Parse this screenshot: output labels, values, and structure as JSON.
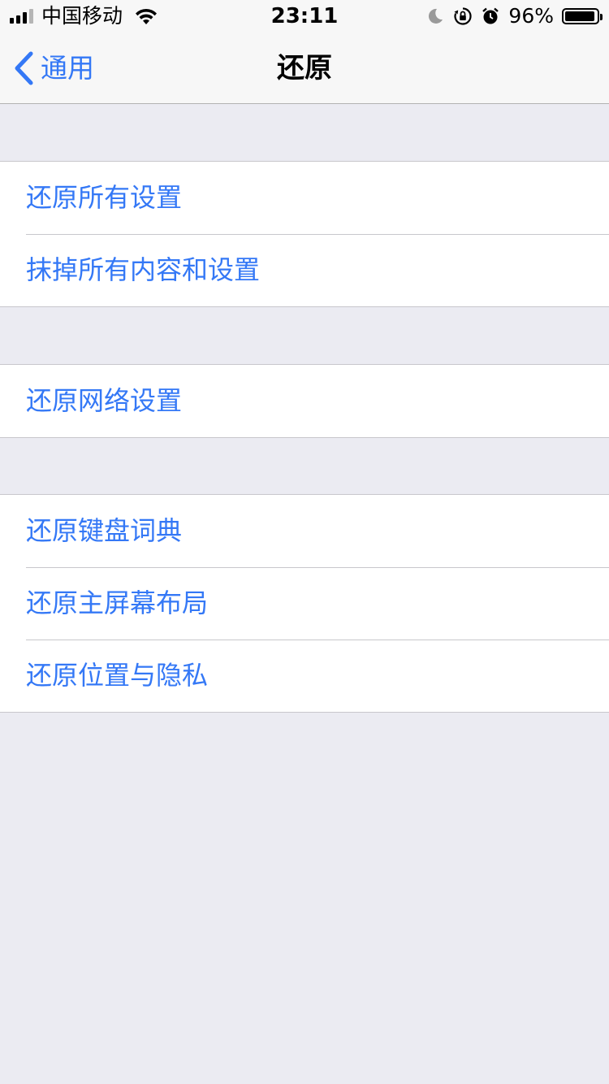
{
  "status_bar": {
    "carrier": "中国移动",
    "time": "23:11",
    "battery_percent": "96%",
    "battery_level": 0.96
  },
  "nav": {
    "back_label": "通用",
    "title": "还原"
  },
  "groups": [
    {
      "items": [
        {
          "label": "还原所有设置"
        },
        {
          "label": "抹掉所有内容和设置"
        }
      ]
    },
    {
      "items": [
        {
          "label": "还原网络设置"
        }
      ]
    },
    {
      "items": [
        {
          "label": "还原键盘词典"
        },
        {
          "label": "还原主屏幕布局"
        },
        {
          "label": "还原位置与隐私"
        }
      ]
    }
  ],
  "colors": {
    "accent": "#3478f6",
    "background": "#ebebf2"
  }
}
